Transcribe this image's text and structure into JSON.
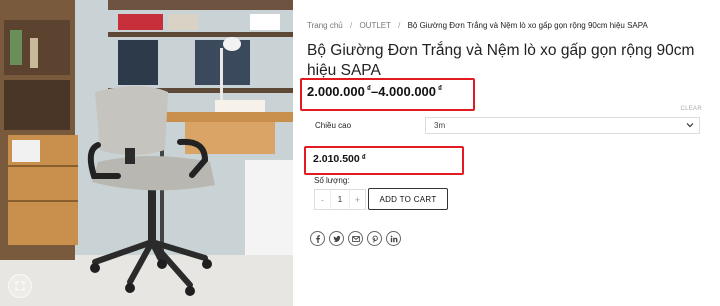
{
  "breadcrumb": {
    "items": [
      "Trang chủ",
      "OUTLET"
    ],
    "separator": "/",
    "current": "Bộ Giường Đơn Trắng và Nệm lò xo gấp gọn rộng 90cm hiệu SAPA"
  },
  "product": {
    "title": "Bộ Giường Đơn Trắng và Nệm lò xo gấp gọn rộng 90cm hiệu SAPA",
    "price_min": "2.000.000",
    "price_sep": "–",
    "price_max": "4.000.000",
    "currency": "₫",
    "image_icon": "office-chair-photo"
  },
  "variation": {
    "clear_label": "CLEAR",
    "label": "Chiều cao",
    "selected": "3m",
    "price": "2.010.500"
  },
  "quantity": {
    "label": "Số lượng:",
    "minus": "-",
    "value": "1",
    "plus": "+"
  },
  "cart": {
    "add_label": "ADD TO CART"
  },
  "share_icons": [
    "facebook-icon",
    "twitter-icon",
    "email-icon",
    "pinterest-icon",
    "linkedin-icon"
  ],
  "colors": {
    "highlight": "#e21b23",
    "text": "#111111",
    "muted": "#777777"
  }
}
